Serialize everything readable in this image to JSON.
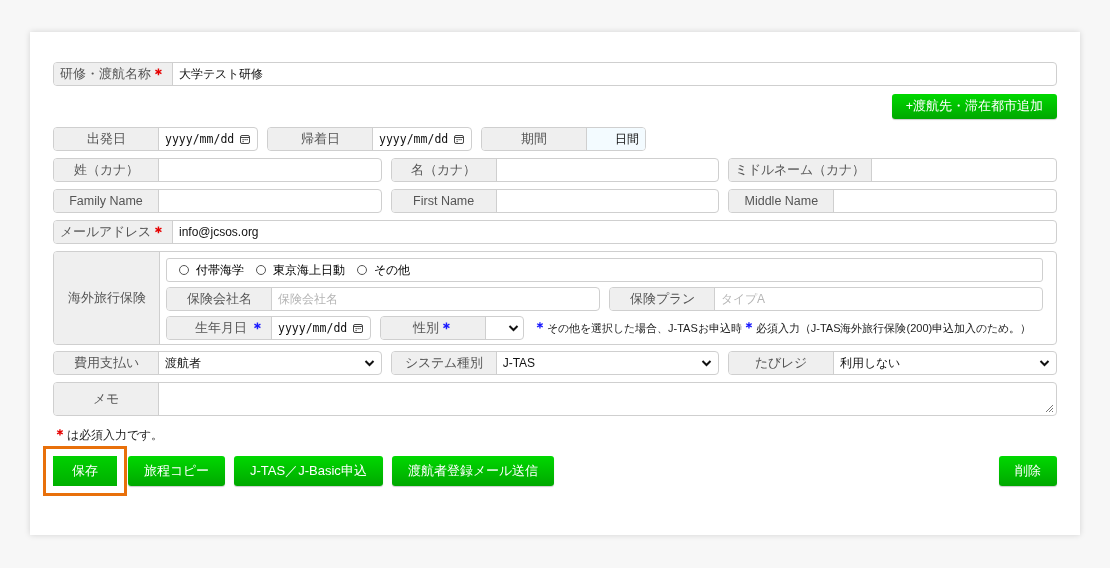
{
  "title_field": {
    "kind": "text",
    "label": "研修・渡航名称",
    "mark": {
      "text": "＊",
      "color": "#e60000"
    },
    "value": "大学テスト研修"
  },
  "add_destination_button": {
    "label": "+渡航先・滞在都市追加"
  },
  "rows": [
    [
      {
        "kind": "date",
        "label": "出発日",
        "placeholder": "yyyy/mm/dd"
      },
      {
        "kind": "date",
        "label": "帰着日",
        "placeholder": "yyyy/mm/dd"
      },
      {
        "kind": "duration",
        "label": "期間",
        "suffix": "日間"
      }
    ],
    [
      {
        "kind": "text",
        "label": "姓（カナ）"
      },
      {
        "kind": "text",
        "label": "名（カナ）"
      },
      {
        "kind": "text",
        "label": "ミドルネーム（カナ）"
      }
    ],
    [
      {
        "kind": "text",
        "label": "Family Name"
      },
      {
        "kind": "text",
        "label": "First Name"
      },
      {
        "kind": "text",
        "label": "Middle Name"
      }
    ],
    [
      {
        "kind": "text",
        "label": "メールアドレス",
        "mark": {
          "text": "＊",
          "color": "#e60000"
        },
        "value": "info@jcsos.org"
      }
    ]
  ],
  "insurance": {
    "label": "海外旅行保険",
    "options": [
      {
        "label": "付帯海学",
        "selected": false
      },
      {
        "label": "東京海上日動",
        "selected": false
      },
      {
        "label": "その他",
        "selected": false
      }
    ],
    "fields": [
      {
        "kind": "text",
        "label": "保険会社名",
        "placeholder": "保険会社名"
      },
      {
        "kind": "text",
        "label": "保険プラン",
        "placeholder": "タイプA"
      }
    ],
    "detail_fields": [
      {
        "kind": "date",
        "label": "生年月日",
        "mark": {
          "text": "＊",
          "color": "#1a1aff"
        },
        "placeholder": "yyyy/mm/dd"
      },
      {
        "kind": "select",
        "label": "性別",
        "mark": {
          "text": "＊",
          "color": "#1a1aff"
        }
      }
    ],
    "note": [
      {
        "text": "＊",
        "color": "#1a1aff"
      },
      {
        "text": "その他を選択した場合、J-TASお申込時"
      },
      {
        "text": "＊",
        "color": "#1a1aff"
      },
      {
        "text": "必須入力（J-TAS海外旅行保険(200)申込加入のため。）"
      }
    ]
  },
  "select_row": [
    {
      "kind": "select",
      "label": "費用支払い",
      "value": "渡航者"
    },
    {
      "kind": "select",
      "label": "システム種別",
      "value": "J-TAS"
    },
    {
      "kind": "select",
      "label": "たびレジ",
      "value": "利用しない"
    }
  ],
  "memo": {
    "kind": "textarea",
    "label": "メモ"
  },
  "required_note": [
    {
      "text": "＊",
      "color": "#e60000"
    },
    {
      "text": "は必須入力です。"
    }
  ],
  "buttons": [
    {
      "label": "保存",
      "highlighted": true
    },
    {
      "label": "旅程コピー",
      "highlighted": false
    },
    {
      "label": "J-TAS／J-Basic申込",
      "highlighted": false
    },
    {
      "label": "渡航者登録メール送信",
      "highlighted": false
    }
  ],
  "delete_button": {
    "label": "削除"
  }
}
